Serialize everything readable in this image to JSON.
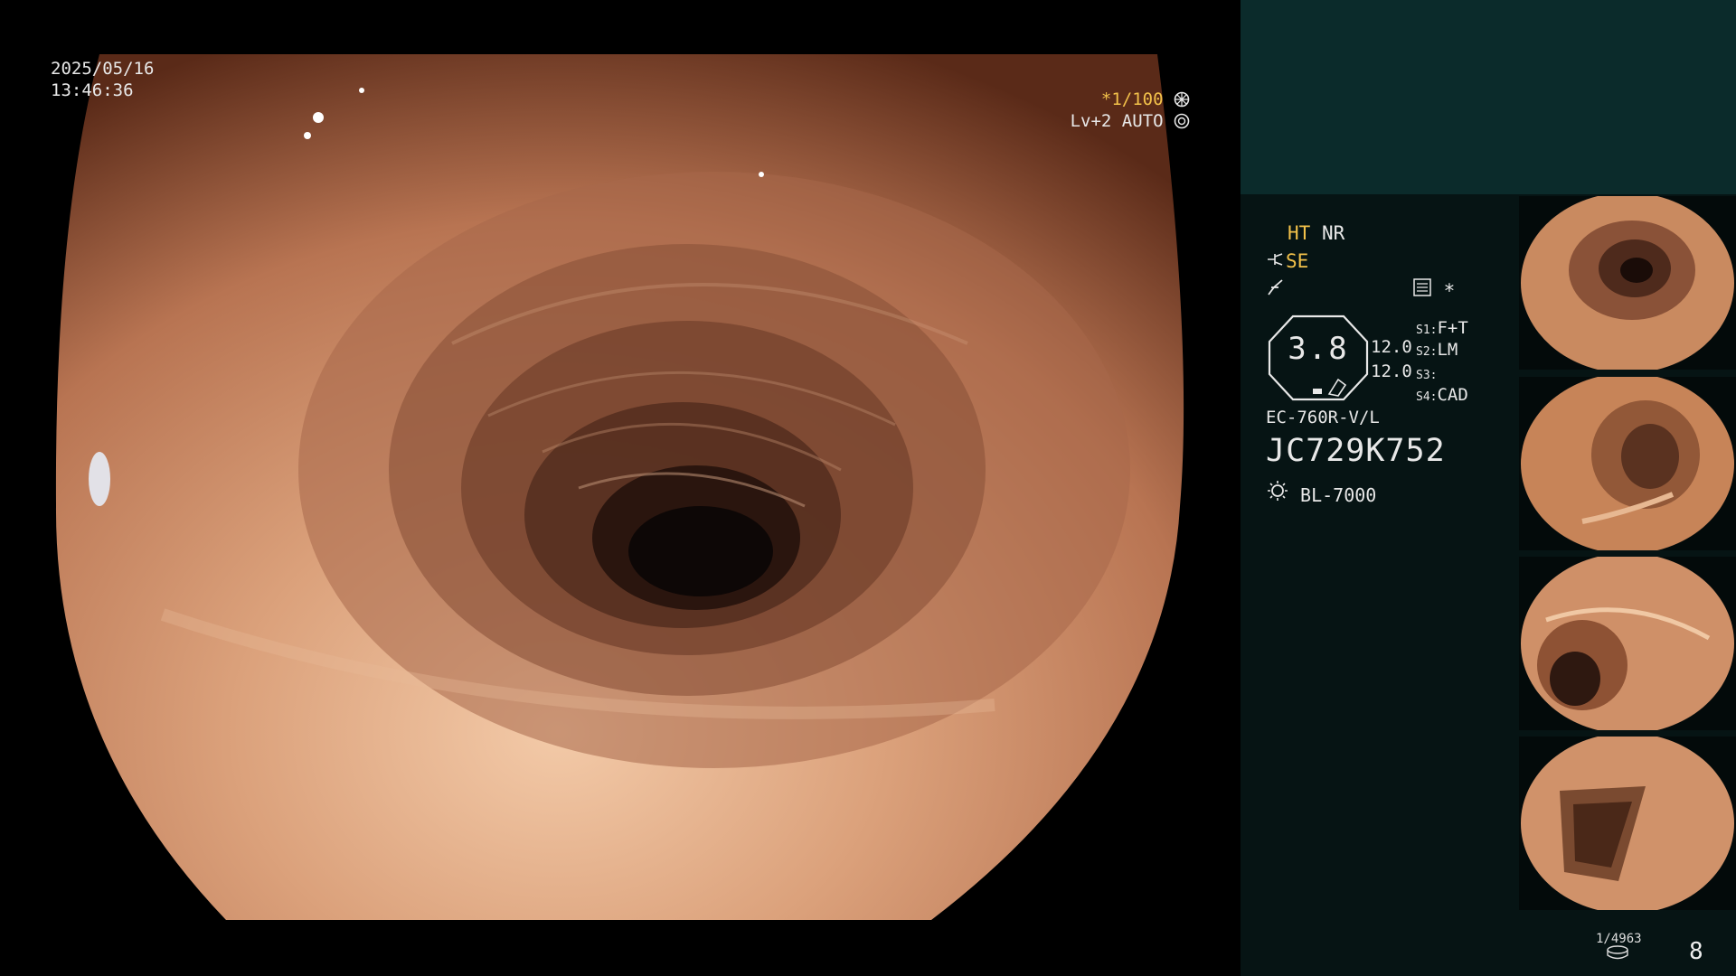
{
  "overlay": {
    "date": "2025/05/16",
    "time": "13:46:36",
    "shutter": "*1/100",
    "iris": "Lv+2 AUTO"
  },
  "status": {
    "ht": "HT",
    "nr": "NR",
    "se": "SE",
    "memory_marker": "*",
    "brightness": "3.8",
    "gain_1": "12.0",
    "gain_2": "12.0",
    "switches": [
      {
        "key": "S1:",
        "value": "F+T"
      },
      {
        "key": "S2:",
        "value": "LM"
      },
      {
        "key": "S3:",
        "value": ""
      },
      {
        "key": "S4:",
        "value": "CAD"
      }
    ],
    "scope_model": "EC-760R-V/L",
    "scope_serial": "JC729K752",
    "light_source": "BL-7000"
  },
  "footer": {
    "counter": "1/4963",
    "capture_count": "8"
  },
  "colors": {
    "panel_header": "#0b2b2b",
    "panel_body": "#061414",
    "osd_yellow": "#f2c14a",
    "mucosa": "#c98a60"
  },
  "icons": [
    "iris-icon",
    "auto-iris-icon",
    "cable-icon",
    "freeze-icon",
    "memory-icon",
    "light-source-icon",
    "capture-icon"
  ],
  "thumbnails": [
    "thumbnail-1",
    "thumbnail-2",
    "thumbnail-3",
    "thumbnail-4"
  ]
}
